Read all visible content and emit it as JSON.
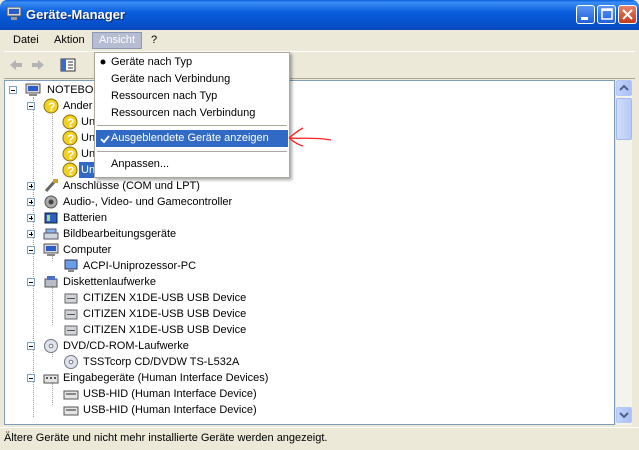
{
  "window": {
    "title": "Geräte-Manager"
  },
  "menubar": {
    "items": [
      "Datei",
      "Aktion",
      "Ansicht",
      "?"
    ]
  },
  "ansicht_menu": {
    "items": [
      {
        "label": "Geräte nach Typ"
      },
      {
        "label": "Geräte nach Verbindung"
      },
      {
        "label": "Ressourcen nach Typ"
      },
      {
        "label": "Ressourcen nach Verbindung"
      },
      {
        "label": "Ausgeblendete Geräte anzeigen"
      },
      {
        "label": "Anpassen..."
      }
    ]
  },
  "tree": {
    "root": "NOTEBOO",
    "category_other": "Ander",
    "unknown_items": [
      "Un",
      "Un",
      "Un",
      "Un"
    ],
    "categories": [
      "Anschlüsse (COM und LPT)",
      "Audio-, Video- und Gamecontroller",
      "Batterien",
      "Bildbearbeitungsgeräte"
    ],
    "computer": {
      "label": "Computer",
      "child": "ACPI-Uniprozessor-PC"
    },
    "disk": {
      "label": "Diskettenlaufwerke",
      "children": [
        "CITIZEN X1DE-USB USB Device",
        "CITIZEN X1DE-USB USB Device",
        "CITIZEN X1DE-USB USB Device"
      ]
    },
    "dvd": {
      "label": "DVD/CD-ROM-Laufwerke",
      "child": "TSSTcorp CD/DVDW TS-L532A"
    },
    "hid": {
      "label": "Eingabegeräte (Human Interface Devices)",
      "children": [
        "USB-HID (Human Interface Device)",
        "USB-HID (Human Interface Device)"
      ]
    }
  },
  "statusbar": {
    "text": "Ältere Geräte und nicht mehr installierte Geräte werden angezeigt."
  },
  "colors": {
    "titlebar": "#0a5fdc",
    "selection": "#316ac5",
    "annotation": "#ff2020"
  }
}
